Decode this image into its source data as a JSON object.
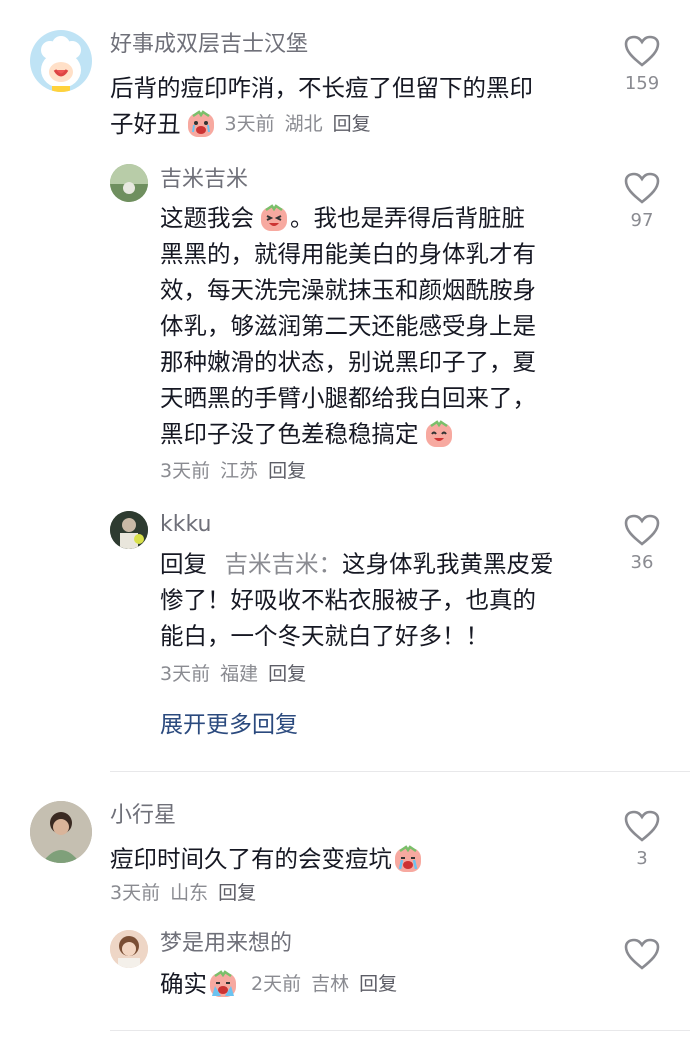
{
  "comments": [
    {
      "user": "好事成双层吉士汉堡",
      "text_a": "后背的痘印咋消，不长痘了但留下的黑印",
      "text_b": "子好丑",
      "emoji": "crying-emoji",
      "time": "3天前",
      "location": "湖北",
      "reply_label": "回复",
      "likes": "159"
    },
    {
      "user": "吉米吉米",
      "text_l1a": "这题我会",
      "text_l1b": "。我也是弄得后背脏脏",
      "text_l2": "黑黑的，就得用能美白的身体乳才有",
      "text_l3": "效，每天洗完澡就抹玉和颜烟酰胺身",
      "text_l4": "体乳，够滋润第二天还能感受身上是",
      "text_l5": "那种嫩滑的状态，别说黑印子了，夏",
      "text_l6": "天晒黑的手臂小腿都给我白回来了，",
      "text_l7": "黑印子没了色差稳稳搞定",
      "time": "3天前",
      "location": "江苏",
      "reply_label": "回复",
      "likes": "97"
    },
    {
      "user": "kkku",
      "reply_prefix": "回复",
      "reply_to": "吉米吉米：",
      "text_l1": "这身体乳我黄黑皮爱",
      "text_l2": "惨了！好吸收不粘衣服被子，也真的",
      "text_l3": "能白，一个冬天就白了好多！！",
      "time": "3天前",
      "location": "福建",
      "reply_label": "回复",
      "likes": "36"
    },
    {
      "user": "小行星",
      "text": "痘印时间久了有的会变痘坑",
      "time": "3天前",
      "location": "山东",
      "reply_label": "回复",
      "likes": "3"
    },
    {
      "user": "梦是用来想的",
      "text": "确实",
      "time": "2天前",
      "location": "吉林",
      "reply_label": "回复"
    }
  ],
  "expand_replies": "展开更多回复",
  "colors": {
    "link": "#2b4a7e",
    "meta": "#8a8b91",
    "text": "#161823"
  },
  "icons": [
    "heart-icon",
    "crying-emoji",
    "laughing-emoji",
    "happy-emoji"
  ]
}
